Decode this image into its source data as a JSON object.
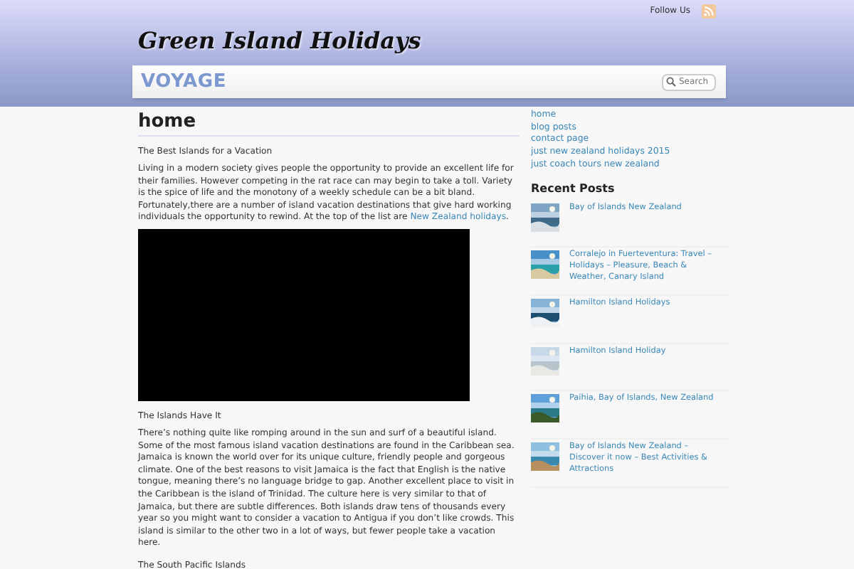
{
  "top_bar": {
    "follow_label": "Follow Us"
  },
  "site_title": "Green Island Holidays",
  "nav": {
    "logo": "VOYAGE",
    "search": {
      "placeholder": "Search"
    }
  },
  "page_title": "home",
  "article": [
    {
      "kind": "subheading",
      "text": "The Best Islands for a Vacation"
    },
    {
      "kind": "paragraph",
      "text": "Living in a modern society gives people the opportunity to provide an excellent life for their families. However competing in the rat race can may begin to take a toll. Variety is the spice of life and the monotony of a weekly schedule can be a bit bland. Fortunately,there are a number of island vacation destinations that give hard working individuals the opportunity to rewind. At the top of the list are ",
      "link": "New Zealand holidays",
      "after": "."
    },
    {
      "kind": "video"
    },
    {
      "kind": "subheading",
      "text": "The Islands Have It"
    },
    {
      "kind": "paragraph",
      "text": "There’s nothing quite like romping around in the sun and surf of a beautiful island. Some of the most famous island vacation destinations are found in the Caribbean sea. Jamaica is known the world over for its unique culture, friendly people and gorgeous climate. One of the best reasons to visit Jamaica is the fact that English is the native tongue, meaning there’s no language bridge to gap. Another excellent place to visit in the Caribbean is the island of Trinidad. The culture here is very similar to that of Jamaica, but there are subtle differences. Both islands draw tens of thousands every year so you might want to consider a vacation to Antigua if you don’t like crowds. This island is similar to the other two in a lot of ways, but fewer people take a vacation here."
    },
    {
      "kind": "subheading",
      "text": "The South Pacific Islands"
    }
  ],
  "sidebar": {
    "pages": [
      "home",
      "blog posts",
      "contact page",
      "just new zealand holidays 2015",
      "just coach tours new zealand"
    ],
    "recent_heading": "Recent Posts",
    "recent_posts": [
      {
        "title": "Bay of Islands New Zealand"
      },
      {
        "title": "Corralejo in Fuerteventura: Travel – Holidays – Pleasure, Beach & Weather, Canary Island"
      },
      {
        "title": "Hamilton Island Holidays"
      },
      {
        "title": "Hamilton Island Holiday"
      },
      {
        "title": "Paihia, Bay of Islands, New Zealand"
      },
      {
        "title": "Bay of Islands New Zealand – Discover it now – Best Activities & Attractions"
      }
    ]
  }
}
